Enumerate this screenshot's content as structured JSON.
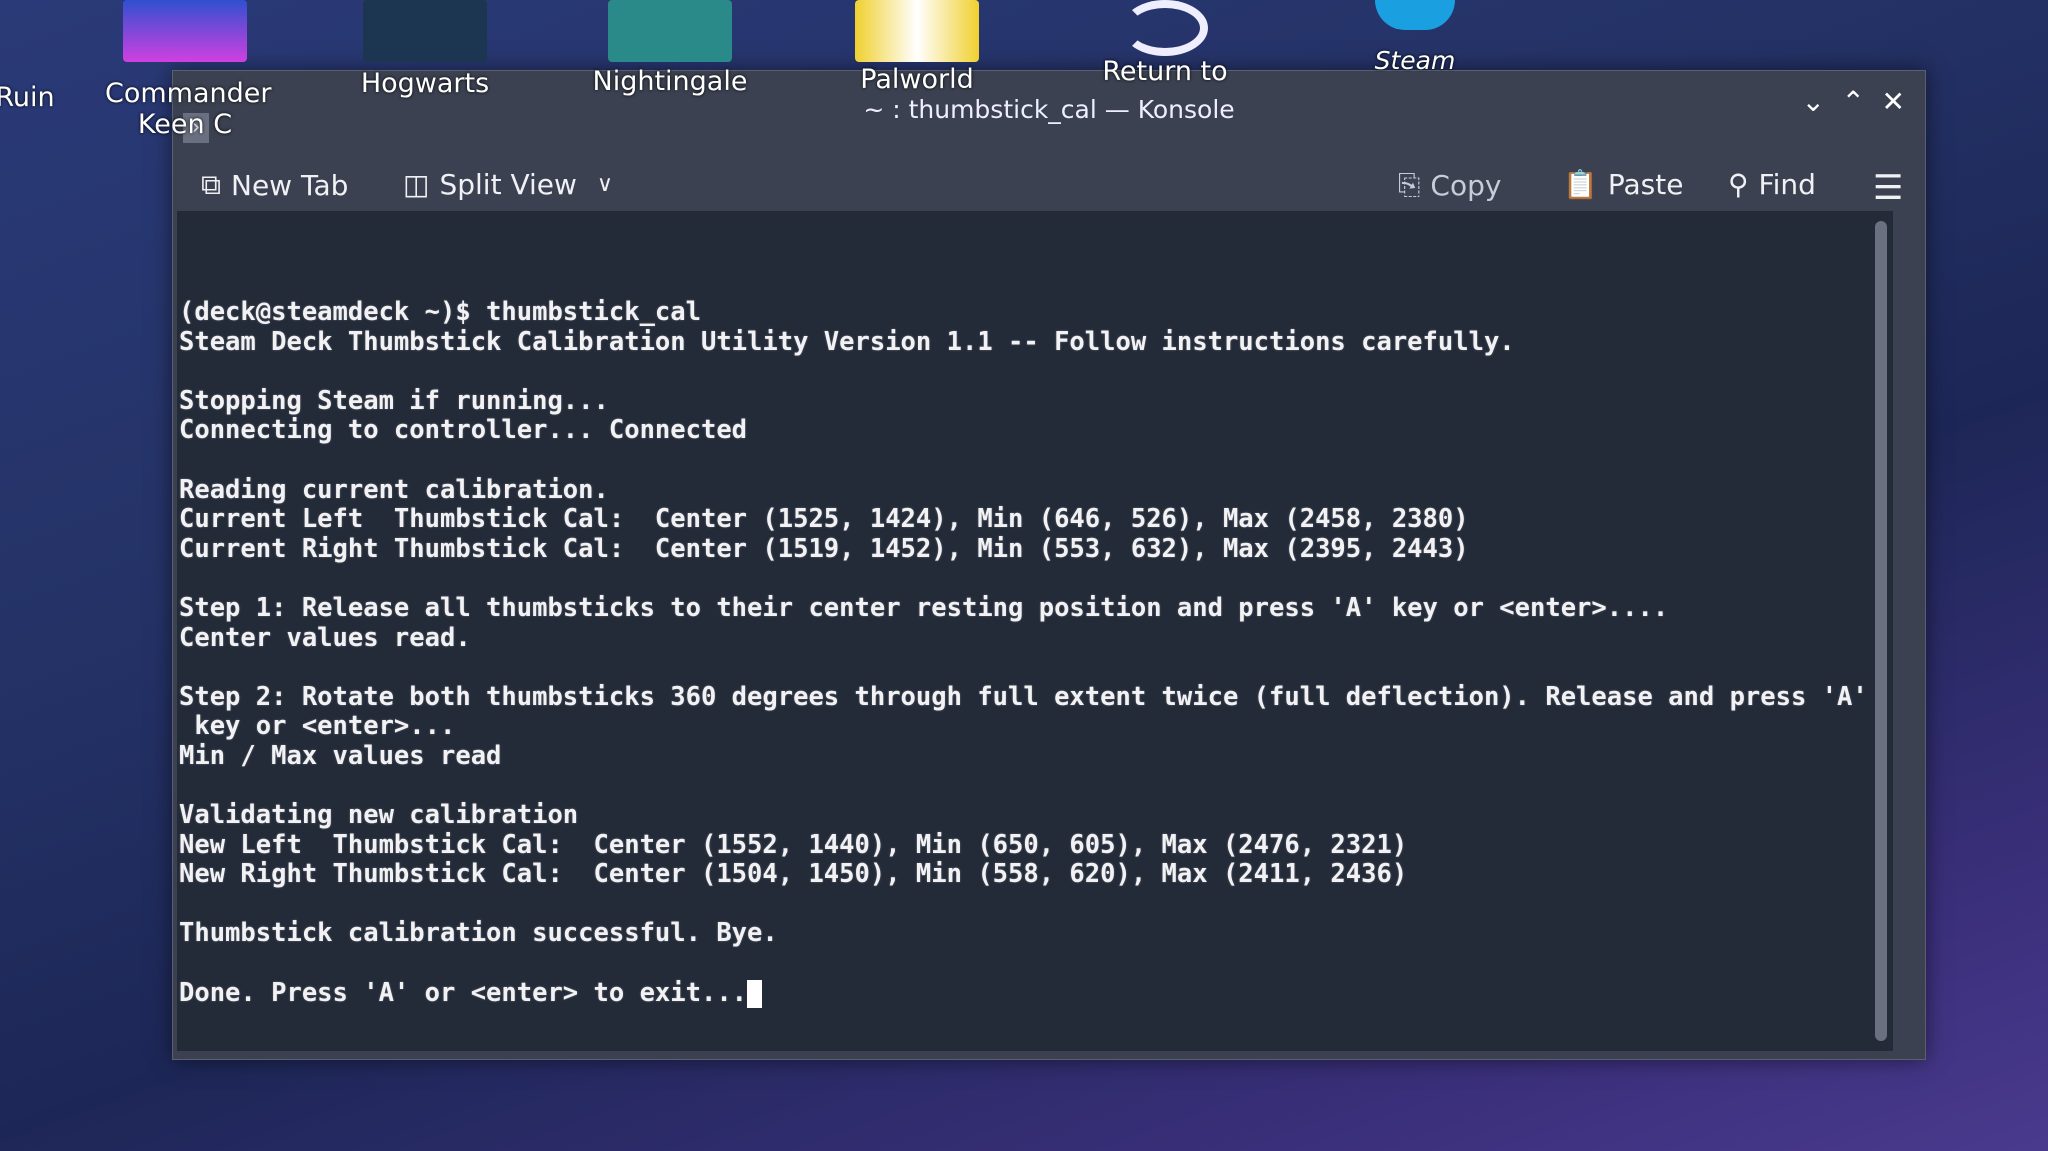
{
  "desktop": {
    "icons": [
      {
        "label": "Ruin",
        "color": "#2a3a78"
      },
      {
        "label": "Commander Keen C",
        "color": "#6a3ad0"
      },
      {
        "label": "Hogwarts",
        "color": "#1f3a5a"
      },
      {
        "label": "Nightingale",
        "color": "#2a8a8a"
      },
      {
        "label": "Palworld",
        "color": "#f0d030"
      },
      {
        "label": "Return to",
        "color": "#2a3a78"
      },
      {
        "label": "Steam",
        "color": "#1aa0e0"
      }
    ]
  },
  "window": {
    "title": "~ : thumbstick_cal — Konsole",
    "controls": {
      "minimize": "⌄",
      "maximize": "⌃",
      "close": "✕"
    }
  },
  "toolbar": {
    "new_tab": "New Tab",
    "split_view": "Split View",
    "copy": "Copy",
    "paste": "Paste",
    "find": "Find"
  },
  "terminal": {
    "prompt": "(deck@steamdeck ~)$ ",
    "command": "thumbstick_cal",
    "lines": [
      "Steam Deck Thumbstick Calibration Utility Version 1.1 -- Follow instructions carefully.",
      "",
      "Stopping Steam if running...",
      "Connecting to controller... Connected",
      "",
      "Reading current calibration.",
      "Current Left  Thumbstick Cal:  Center (1525, 1424), Min (646, 526), Max (2458, 2380)",
      "Current Right Thumbstick Cal:  Center (1519, 1452), Min (553, 632), Max (2395, 2443)",
      "",
      "Step 1: Release all thumbsticks to their center resting position and press 'A' key or <enter>....",
      "Center values read.",
      "",
      "Step 2: Rotate both thumbsticks 360 degrees through full extent twice (full deflection). Release and press 'A'",
      " key or <enter>...",
      "Min / Max values read",
      "",
      "Validating new calibration",
      "New Left  Thumbstick Cal:  Center (1552, 1440), Min (650, 605), Max (2476, 2321)",
      "New Right Thumbstick Cal:  Center (1504, 1450), Min (558, 620), Max (2411, 2436)",
      "",
      "Thumbstick calibration successful. Bye.",
      "",
      "Done. Press 'A' or <enter> to exit..."
    ]
  }
}
